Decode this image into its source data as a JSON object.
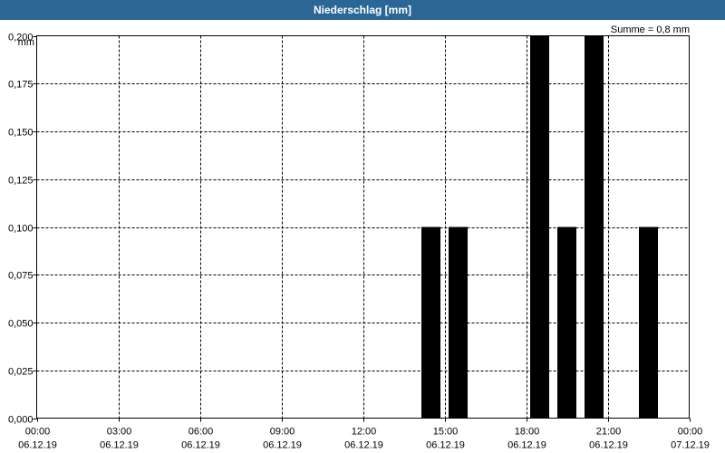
{
  "window": {
    "title": "Niederschlag [mm]"
  },
  "summary": "Summe = 0,8 mm",
  "chart_data": {
    "type": "bar",
    "title": "Niederschlag [mm]",
    "ylabel": "mm",
    "ylim": [
      0,
      0.2
    ],
    "y_ticks": [
      "0,000",
      "0,025",
      "0,050",
      "0,075",
      "0,100",
      "0,125",
      "0,150",
      "0,175",
      "0,200"
    ],
    "x_range_hours": [
      0,
      24
    ],
    "x_ticks": [
      {
        "time": "00:00",
        "date": "06.12.19"
      },
      {
        "time": "03:00",
        "date": "06.12.19"
      },
      {
        "time": "06:00",
        "date": "06.12.19"
      },
      {
        "time": "09:00",
        "date": "06.12.19"
      },
      {
        "time": "12:00",
        "date": "06.12.19"
      },
      {
        "time": "15:00",
        "date": "06.12.19"
      },
      {
        "time": "18:00",
        "date": "06.12.19"
      },
      {
        "time": "21:00",
        "date": "06.12.19"
      },
      {
        "time": "00:00",
        "date": "07.12.19"
      }
    ],
    "bars": [
      {
        "hour": 14.5,
        "value": 0.1
      },
      {
        "hour": 15.5,
        "value": 0.1
      },
      {
        "hour": 18.5,
        "value": 0.2
      },
      {
        "hour": 19.5,
        "value": 0.1
      },
      {
        "hour": 20.5,
        "value": 0.2
      },
      {
        "hour": 22.5,
        "value": 0.1
      }
    ],
    "bar_color": "#000000",
    "grid": true
  }
}
